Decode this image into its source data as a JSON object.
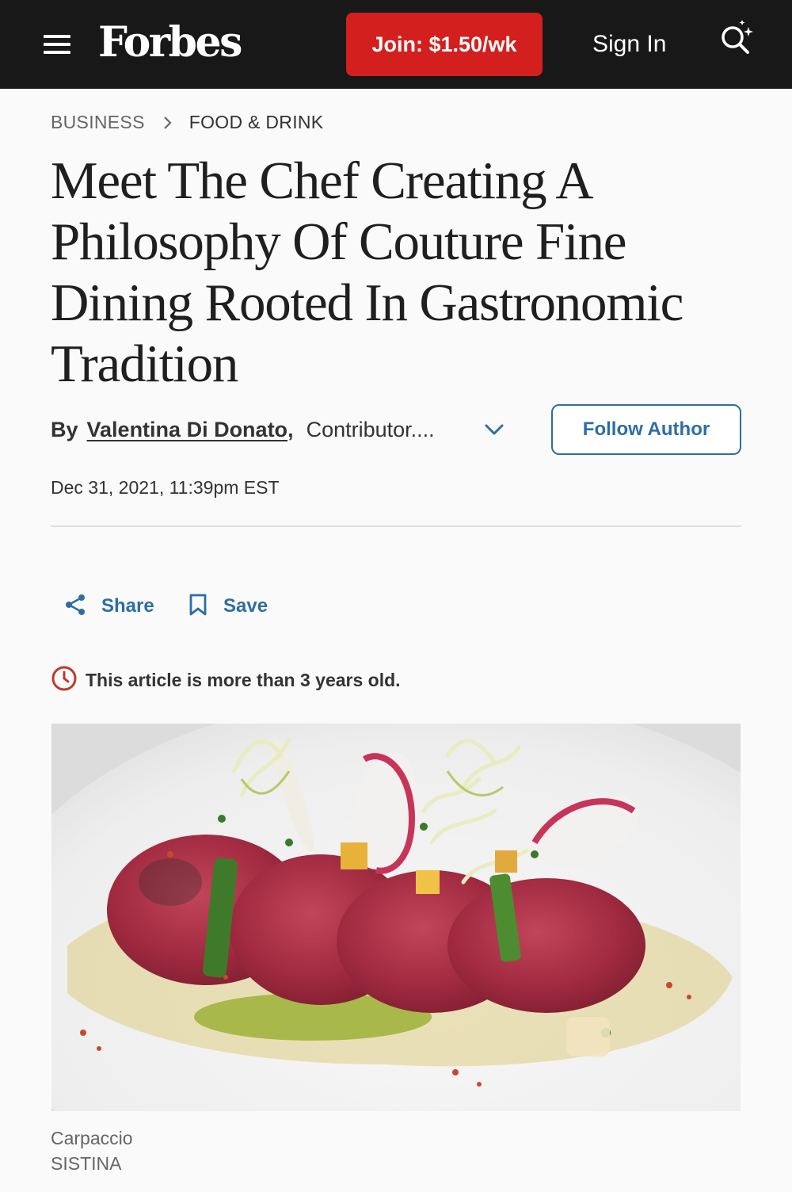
{
  "header": {
    "logo": "Forbes",
    "join_label": "Join: $1.50/wk",
    "signin_label": "Sign In",
    "menu_icon": "hamburger-menu-icon",
    "search_icon": "search-sparkle-icon",
    "colors": {
      "bar": "#181818",
      "join": "#d41f1f"
    }
  },
  "breadcrumb": {
    "items": [
      "BUSINESS",
      "FOOD & DRINK"
    ],
    "separator_icon": "chevron-right-icon"
  },
  "article": {
    "headline": "Meet The Chef Creating A Philosophy Of Couture Fine Dining Rooted In Gastronomic Tradition",
    "by_label": "By",
    "author": "Valentina Di Donato",
    "author_role": "Contributor....",
    "follow_label": "Follow Author",
    "date": "Dec 31, 2021, 11:39pm EST",
    "share_label": "Share",
    "save_label": "Save",
    "age_notice": "This article is more than 3 years old.",
    "image": {
      "caption": "Carpaccio",
      "credit": "SISTINA"
    },
    "accent_color": "#2e6da4"
  }
}
